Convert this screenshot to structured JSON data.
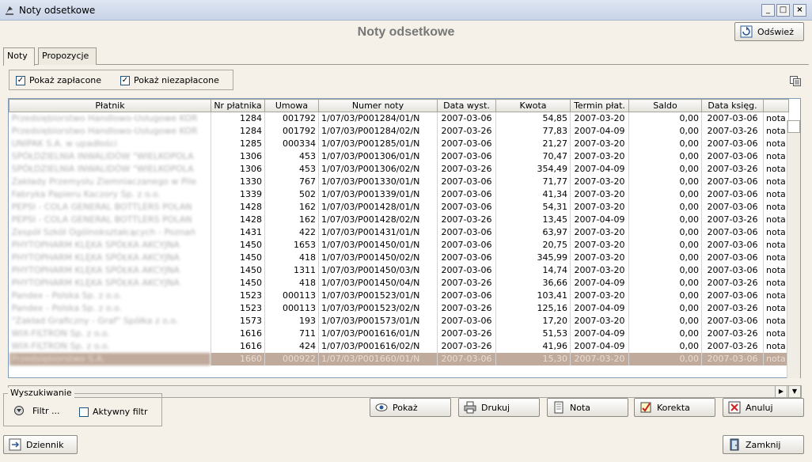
{
  "window": {
    "title": "Noty odsetkowe",
    "minimize": "_",
    "maximize": "□",
    "close": "×"
  },
  "page_title": "Noty odsetkowe",
  "refresh_label": "Odśwież",
  "tabs": [
    {
      "label": "Noty"
    },
    {
      "label": "Propozycje"
    }
  ],
  "filters": {
    "paid_label": "Pokaż zapłacone",
    "paid_checked": true,
    "unpaid_label": "Pokaż niezapłacone",
    "unpaid_checked": true
  },
  "table": {
    "columns": [
      "Płatnik",
      "Nr płatnika",
      "Umowa",
      "Numer noty",
      "Data wyst.",
      "Kwota",
      "Termin płat.",
      "Saldo",
      "Data księg.",
      ""
    ],
    "rows": [
      [
        "Przedsiębiorstwo Handlowo-Usługowe  KOR",
        "1284",
        "001792",
        "1/07/03/P001284/01/N",
        "2007-03-06",
        "54,85",
        "2007-03-20",
        "0,00",
        "2007-03-06",
        "nota"
      ],
      [
        "Przedsiębiorstwo Handlowo-Usługowe  KOR",
        "1284",
        "001792",
        "1/07/03/P001284/02/N",
        "2007-03-26",
        "77,83",
        "2007-04-09",
        "0,00",
        "2007-03-26",
        "nota"
      ],
      [
        "UNIPAK S.A. w upadłości",
        "1285",
        "000334",
        "1/07/03/P001285/01/N",
        "2007-03-06",
        "21,27",
        "2007-03-20",
        "0,00",
        "2007-03-06",
        "nota"
      ],
      [
        "SPÓŁDZIELNIA INWALIDÓW \"WIELKOPOLA",
        "1306",
        "453",
        "1/07/03/P001306/01/N",
        "2007-03-06",
        "70,47",
        "2007-03-20",
        "0,00",
        "2007-03-06",
        "nota"
      ],
      [
        "SPÓŁDZIELNIA INWALIDÓW \"WIELKOPOLA",
        "1306",
        "453",
        "1/07/03/P001306/02/N",
        "2007-03-26",
        "354,49",
        "2007-04-09",
        "0,00",
        "2007-03-26",
        "nota"
      ],
      [
        "Zakłady Przemysłu Ziemniaczanego w Pile",
        "1330",
        "767",
        "1/07/03/P001330/01/N",
        "2007-03-06",
        "71,77",
        "2007-03-20",
        "0,00",
        "2007-03-06",
        "nota"
      ],
      [
        "Fabryka Papieru Kaczory Sp. z o.o.",
        "1339",
        "502",
        "1/07/03/P001339/01/N",
        "2007-03-06",
        "41,34",
        "2007-03-20",
        "0,00",
        "2007-03-06",
        "nota"
      ],
      [
        "PEPSI - COLA  GENERAL  BOTTLERS  POLAN",
        "1428",
        "162",
        "1/07/03/P001428/01/N",
        "2007-03-06",
        "54,31",
        "2007-03-20",
        "0,00",
        "2007-03-06",
        "nota"
      ],
      [
        "PEPSI - COLA  GENERAL  BOTTLERS  POLAN",
        "1428",
        "162",
        "1/07/03/P001428/02/N",
        "2007-03-26",
        "13,45",
        "2007-04-09",
        "0,00",
        "2007-03-26",
        "nota"
      ],
      [
        "Zespół Szkół Ogólnokształcących - Poznań",
        "1431",
        "422",
        "1/07/03/P001431/01/N",
        "2007-03-06",
        "63,97",
        "2007-03-20",
        "0,00",
        "2007-03-06",
        "nota"
      ],
      [
        "PHYTOPHARM KLĘKA SPÓŁKA AKCYJNA",
        "1450",
        "1653",
        "1/07/03/P001450/01/N",
        "2007-03-06",
        "20,75",
        "2007-03-20",
        "0,00",
        "2007-03-06",
        "nota"
      ],
      [
        "PHYTOPHARM KLĘKA SPÓŁKA AKCYJNA",
        "1450",
        "418",
        "1/07/03/P001450/02/N",
        "2007-03-06",
        "345,99",
        "2007-03-20",
        "0,00",
        "2007-03-06",
        "nota"
      ],
      [
        "PHYTOPHARM KLĘKA SPÓŁKA AKCYJNA",
        "1450",
        "1311",
        "1/07/03/P001450/03/N",
        "2007-03-06",
        "14,74",
        "2007-03-20",
        "0,00",
        "2007-03-06",
        "nota"
      ],
      [
        "PHYTOPHARM KLĘKA SPÓŁKA AKCYJNA",
        "1450",
        "418",
        "1/07/03/P001450/04/N",
        "2007-03-26",
        "36,66",
        "2007-04-09",
        "0,00",
        "2007-03-26",
        "nota"
      ],
      [
        "Pandex - Polska Sp. z o.o.",
        "1523",
        "000113",
        "1/07/03/P001523/01/N",
        "2007-03-06",
        "103,41",
        "2007-03-20",
        "0,00",
        "2007-03-06",
        "nota"
      ],
      [
        "Pandex - Polska Sp. z o.o.",
        "1523",
        "000113",
        "1/07/03/P001523/02/N",
        "2007-03-26",
        "125,16",
        "2007-04-09",
        "0,00",
        "2007-03-26",
        "nota"
      ],
      [
        "\"Zakład Graficzny - Graf\" Spółka z o.o.",
        "1573",
        "193",
        "1/07/03/P001573/01/N",
        "2007-03-06",
        "17,20",
        "2007-03-20",
        "0,00",
        "2007-03-06",
        "nota"
      ],
      [
        "WIX-FILTRON  Sp.  z o.o.",
        "1616",
        "711",
        "1/07/03/P001616/01/N",
        "2007-03-26",
        "51,53",
        "2007-04-09",
        "0,00",
        "2007-03-26",
        "nota"
      ],
      [
        "WIX-FILTRON  Sp.  z o.o.",
        "1616",
        "424",
        "1/07/03/P001616/02/N",
        "2007-03-26",
        "41,96",
        "2007-04-09",
        "0,00",
        "2007-03-26",
        "nota"
      ],
      [
        "Przedsiębiorstwo S.A.",
        "1660",
        "000922",
        "1/07/03/P001660/01/N",
        "2007-03-06",
        "15,30",
        "2007-03-20",
        "0,00",
        "2007-03-06",
        "nota"
      ]
    ],
    "selected_row": 19
  },
  "search": {
    "legend": "Wyszukiwanie",
    "filter_label": "Filtr ...",
    "active_filter_label": "Aktywny filtr",
    "active_filter_checked": false
  },
  "actions": {
    "show": "Pokaż",
    "print": "Drukuj",
    "note": "Nota",
    "correction": "Korekta",
    "cancel": "Anuluj"
  },
  "journal_label": "Dziennik",
  "close_label": "Zamknij",
  "colors": {
    "titlebar": "#c9d4e8",
    "selected_row": "#c0aa9c",
    "background": "#f5f1e8"
  }
}
